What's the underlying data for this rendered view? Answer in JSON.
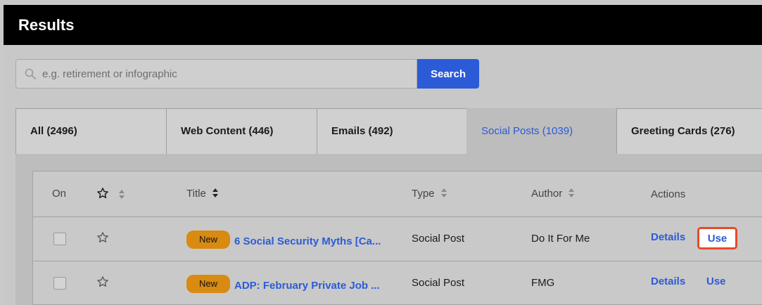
{
  "header": {
    "title": "Results"
  },
  "search": {
    "placeholder": "e.g. retirement or infographic",
    "button_label": "Search"
  },
  "tabs": [
    {
      "label": "All (2496)",
      "active": false
    },
    {
      "label": "Web Content (446)",
      "active": false
    },
    {
      "label": "Emails (492)",
      "active": false
    },
    {
      "label": "Social Posts (1039)",
      "active": true
    },
    {
      "label": "Greeting Cards (276)",
      "active": false
    }
  ],
  "table": {
    "columns": {
      "on": "On",
      "title": "Title",
      "type": "Type",
      "author": "Author",
      "actions": "Actions"
    },
    "rows": [
      {
        "badge": "New",
        "title": "6 Social Security Myths [Ca...",
        "type": "Social Post",
        "author": "Do It For Me",
        "details": "Details",
        "use": "Use"
      },
      {
        "badge": "New",
        "title": "ADP: February Private Job ...",
        "type": "Social Post",
        "author": "FMG",
        "details": "Details",
        "use": "Use"
      }
    ]
  },
  "colors": {
    "accent": "#2b5bd7",
    "badge": "#d98a11",
    "highlight": "#e8492b",
    "header_bg": "#000000"
  },
  "icons": {
    "search": "search-icon",
    "star": "star-icon",
    "sort": "sort-icon"
  }
}
